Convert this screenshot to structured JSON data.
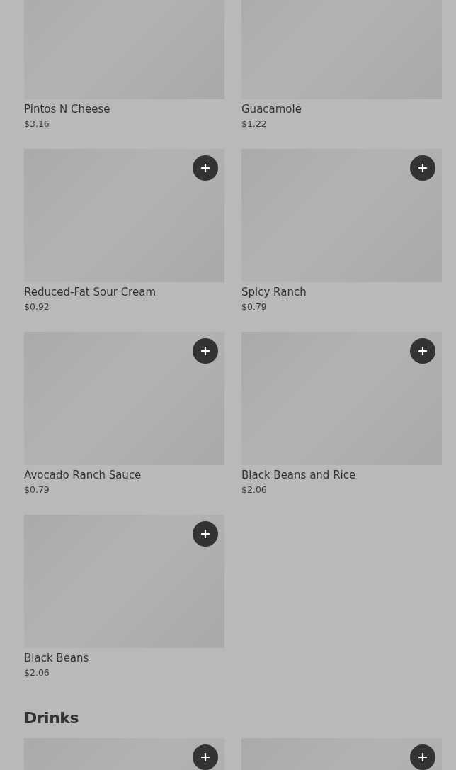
{
  "sections": [
    {
      "items": [
        {
          "name": "Pintos N Cheese",
          "price": "$3.16"
        },
        {
          "name": "Guacamole",
          "price": "$1.22"
        },
        {
          "name": "Reduced-Fat Sour Cream",
          "price": "$0.92",
          "add_button": true
        },
        {
          "name": "Spicy Ranch",
          "price": "$0.79",
          "add_button": true
        },
        {
          "name": "Avocado Ranch Sauce",
          "price": "$0.79",
          "add_button": true
        },
        {
          "name": "Black Beans and Rice",
          "price": "$2.06",
          "add_button": true
        },
        {
          "name": "Black Beans",
          "price": "$2.06",
          "add_button": true
        }
      ]
    },
    {
      "title": "Drinks",
      "items": [
        {
          "add_button": true
        },
        {
          "add_button": true
        }
      ]
    }
  ]
}
